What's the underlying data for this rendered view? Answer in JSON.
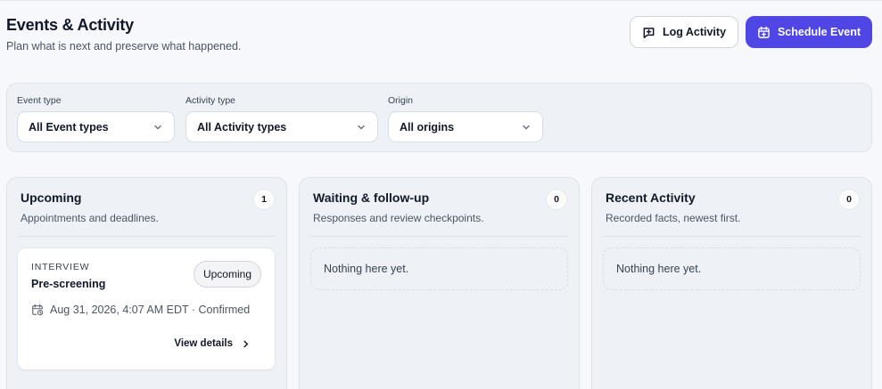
{
  "header": {
    "title": "Events & Activity",
    "subtitle": "Plan what is next and preserve what happened.",
    "log_label": "Log Activity",
    "schedule_label": "Schedule Event"
  },
  "filters": [
    {
      "label": "Event type",
      "value": "All Event types"
    },
    {
      "label": "Activity type",
      "value": "All Activity types"
    },
    {
      "label": "Origin",
      "value": "All origins"
    }
  ],
  "columns": {
    "upcoming": {
      "title": "Upcoming",
      "description": "Appointments and deadlines.",
      "count": "1",
      "events": [
        {
          "type": "INTERVIEW",
          "name": "Pre-screening",
          "status": "Upcoming",
          "datetime": "Aug 31, 2026, 4:07 AM EDT · Confirmed",
          "link_label": "View details"
        }
      ]
    },
    "waiting": {
      "title": "Waiting & follow-up",
      "description": "Responses and review checkpoints.",
      "count": "0",
      "empty_text": "Nothing here yet."
    },
    "recent": {
      "title": "Recent Activity",
      "description": "Recorded facts, newest first.",
      "count": "0",
      "empty_text": "Nothing here yet."
    }
  },
  "icons": {
    "log": "message-plus-icon",
    "schedule": "calendar-plus-icon",
    "dropdown": "chevron-down-icon",
    "event_date": "calendar-clock-icon",
    "details": "chevron-right-icon"
  },
  "colors": {
    "accent": "#4f46e5",
    "background": "#f6f8fb",
    "panel": "#eef2f7"
  }
}
